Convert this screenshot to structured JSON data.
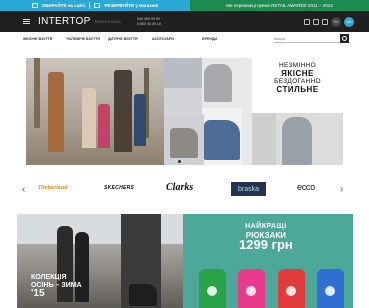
{
  "topbar": {
    "promo1": "ОБИРАЙТЕ на сайті",
    "promo2": "РЕЗЕРВУЙТЕ у магазині",
    "award": "Ми переможці премії RETAIL AWARDS 2011 – 2014"
  },
  "header": {
    "logo": "INTERTOP",
    "logo_sub": "shoes & bags",
    "phone1": "044 499 99 59",
    "phone2": "0 800 30 09 19",
    "lang_ru": "RU",
    "lang_ua": "UA"
  },
  "nav": {
    "items": [
      "ЖІНОЧЕ ВЗУТТЯ",
      "ЧОЛОВІЧЕ ВЗУТТЯ",
      "ДИТЯЧЕ ВЗУТТЯ",
      "АКСЕСУАРИ",
      "БРЕНДИ"
    ],
    "search_placeholder": "пошук"
  },
  "hero": {
    "line1": "НЕЗМІННО",
    "line2": "ЯКІСНЕ",
    "line3": "БЕЗДОГАННО",
    "line4": "СТИЛЬНЕ"
  },
  "brands": {
    "items": [
      "Timberland",
      "SKECHERS",
      "Clarks",
      "braska",
      "ecco"
    ],
    "prev": "‹",
    "next": "›"
  },
  "banners": {
    "left": {
      "line1": "КОЛЕКЦІЯ",
      "line2": "ОСІНЬ – ЗИМА",
      "line3": "'15"
    },
    "right": {
      "line1": "НАЙКРАЩІ",
      "line2": "РЮКЗАКИ",
      "line3": "1299 грн"
    }
  },
  "colors": {
    "topbar_blue": "#2aa9d6",
    "topbar_green": "#1d8b4f",
    "header_bg": "#1f1f1f",
    "banner_teal": "#4da89a"
  }
}
